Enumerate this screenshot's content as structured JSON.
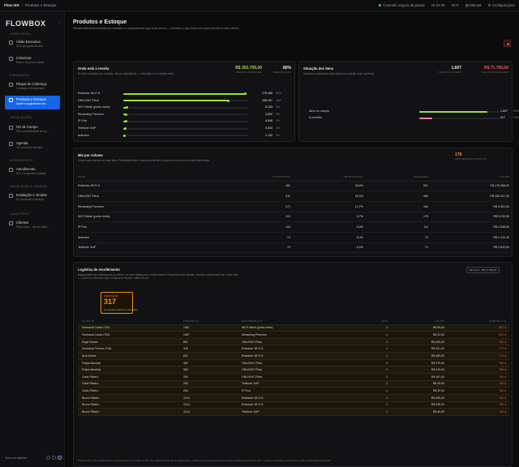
{
  "topbar": {
    "brand": "Flow ISO",
    "sep": "/",
    "crumb": "Produtos e Estoque",
    "status": "Conexão segura da pausa",
    "time": "16:24:30",
    "badge": "IS72",
    "manual": "Manual",
    "settings": "Configurações"
  },
  "sidebar": {
    "logo": "FLOWBOX",
    "caret": "⌃",
    "sections": [
      {
        "label": "VISÃO GERAL"
      },
      {
        "label": "FINANCEIRO"
      },
      {
        "label": "INSTALAÇÕES"
      },
      {
        "label": "ATENDIMENTO"
      },
      {
        "label": "INSTALAÇÃO E VENDAS"
      },
      {
        "label": "CADASTROS"
      }
    ],
    "items": [
      {
        "title": "Visão Executiva",
        "sub": "KPIs principais do mês"
      },
      {
        "title": "Cobertura",
        "sub": "Base e churn por cidade"
      },
      {
        "title": "Régua de Cobrança",
        "sub": "Cobrança e recuperação"
      },
      {
        "title": "Produtos e Estoque",
        "sub": "Upsell e equipamento em..."
      },
      {
        "title": "OS de Campo",
        "sub": "Fila e produtividade da eq..."
      },
      {
        "title": "Agenda",
        "sub": "OS com hora marcada"
      },
      {
        "title": "Atendimento",
        "sub": "SLA e carga dos analistas"
      },
      {
        "title": "Instalação e Vendas",
        "sub": "Do venda até a ativação"
      },
      {
        "title": "Clientes",
        "sub": "Ficha única – tela do client..."
      }
    ],
    "footer": "Tema do sistema"
  },
  "page": {
    "title": "Produtos e Estoque",
    "desc": "Receita adicional vendida por contrato e o equipamento que está na rua — inclusive o que ficou com quem já não é mais cliente."
  },
  "revenue": {
    "title": "Onde está a receita",
    "sub": "Do itens vendidos por contrato, não por quantidade — ordenado e é a receita sobre.",
    "kpi1_value": "R$ 352.705,00",
    "kpi1_label": "RECEITA ADICIONAL",
    "kpi2_value": "80%",
    "kpi2_label": "PENETRAÇÃO",
    "rows": [
      {
        "name": "Roteador Wi-Fi 6",
        "value": "178.458",
        "pct": "51%",
        "share": 0.51
      },
      {
        "name": "ONU/ONT Fibra",
        "value": "155.297",
        "pct": "44%",
        "share": 0.44
      },
      {
        "name": "Wi-Fi Mesh (ponto extra)",
        "value": "5.233",
        "pct": "1%",
        "share": 0.015
      },
      {
        "name": "Streaming Premium",
        "value": "4.502",
        "pct": "1%",
        "share": 0.013
      },
      {
        "name": "IP Fixo",
        "value": "4.548",
        "pct": "1%",
        "share": 0.013
      },
      {
        "name": "Telefone VoIP",
        "value": "3.543",
        "pct": "1%",
        "share": 0.01
      },
      {
        "name": "Antivírus",
        "value": "1.132",
        "pct": "0%",
        "share": 0.003
      }
    ]
  },
  "items_status": {
    "title": "Situação dos itens",
    "sub": "Cada item classificado pelo status do contrato a que pertence.",
    "kpi1_value": "1.607",
    "kpi1_label": "ITENS NO CAMPO",
    "kpi2_value": "R$ 71.760,00",
    "kpi2_label": "VALOR A RECOLHER",
    "rows": [
      {
        "name": "Ativo no campo",
        "value": "1.607",
        "pct": "84%",
        "share": 0.84,
        "color": "#9ce03a"
      },
      {
        "name": "A recolher",
        "value": "317",
        "pct": "16%",
        "share": 0.16,
        "color": "#f07ca8"
      }
    ]
  },
  "mix": {
    "title": "Mix por volume",
    "sub": "O que mais aparece na base ativa. Penetração alta e cobrindo a cliente no plano ter via de por vendido item a item.",
    "kpi_value": "178",
    "kpi_label": "SEM NENHUM PRODUTO",
    "headers": [
      "ITEM",
      "CONTRATOS",
      "PENETRAÇÃO",
      "UNIDADES",
      "VALOR"
    ],
    "rows": [
      [
        "Roteador Wi-Fi 6",
        "452",
        "36,8%",
        "521",
        "R$ 178.458,00"
      ],
      [
        "ONU/ONT Fibra",
        "311",
        "25,3%",
        "486",
        "R$ 155.297,00"
      ],
      [
        "Streaming Premium",
        "171",
        "14,7%",
        "184",
        "R$ 4.501,60"
      ],
      [
        "Wi-Fi Mesh (ponto extra)",
        "113",
        "9,7%",
        "175",
        "R$ 5.232,50"
      ],
      [
        "IP Fixo",
        "110",
        "9,5%",
        "114",
        "R$ 4.548,60"
      ],
      [
        "Antivírus",
        "74",
        "6,4%",
        "74",
        "R$ 1.132,40"
      ],
      [
        "Telefone VoIP",
        "70",
        "6,0%",
        "71",
        "R$ 3.542,60"
      ]
    ]
  },
  "logistics": {
    "title": "Logística de recolhimento",
    "sub": "Equipamento em contrato que já morreu, do mais antigo para o mais recente. Passaram perto dessas, recolher ouvido mais que o item nele — a sua é a coluna do anjo à coluna de dúvida e ativo na rua.",
    "chip": "317 itens · R$ 71.760,00",
    "callout_label": "A RECOLHER",
    "callout_value": "317",
    "callout_sub": "em contratos inativos ou cancelados",
    "headers": [
      "CLIENTE",
      "CONTRATO",
      "EQUIPAMENTO",
      "QTD",
      "VALOR",
      "PARADO HÁ"
    ],
    "rows": [
      [
        "Farmácia Costa LTDA",
        "1067",
        "Wi-Fi Mesh (ponto extra)",
        "2",
        "R$ 59,60",
        "800 d"
      ],
      [
        "Farmácia Costa LTDA",
        "1067",
        "Streaming Premium",
        "1",
        "R$ 24,90",
        "800 d"
      ],
      [
        "Hugo Nunes",
        "891",
        "ONU/ONT Fibra",
        "1",
        "R$ 455,00",
        "783 d"
      ],
      [
        "Farmácia Pereira LTDA",
        "416",
        "Roteador Wi-Fi 6",
        "1",
        "R$ 291,00",
        "772 d"
      ],
      [
        "Ana Nunes",
        "811",
        "Roteador Wi-Fi 6",
        "1",
        "R$ 489,00",
        "770 d"
      ],
      [
        "Felipe Almeida",
        "362",
        "ONU/ONT Fibra",
        "1",
        "R$ 375,00",
        "768 d"
      ],
      [
        "Felipe Almeida",
        "362",
        "ONU/ONT Fibra",
        "1",
        "R$ 319,00",
        "768 d"
      ],
      [
        "Carla Ribeiro",
        "254",
        "ONU/ONT Fibra",
        "1",
        "R$ 467,00",
        "766 d"
      ],
      [
        "Carla Ribeiro",
        "254",
        "Telefone VoIP",
        "1",
        "R$ 49,90",
        "766 d"
      ],
      [
        "Carla Ribeiro",
        "254",
        "IP Fixo",
        "1",
        "R$ 39,90",
        "766 d"
      ],
      [
        "Bruno Ribeiro",
        "1214",
        "Roteador Wi-Fi 6",
        "1",
        "R$ 495,00",
        "754 d"
      ],
      [
        "Bruno Ribeiro",
        "1214",
        "Roteador Wi-Fi 6",
        "1",
        "R$ 398,00",
        "754 d"
      ],
      [
        "Bruno Ribeiro",
        "1214",
        "Telefone VoIP",
        "1",
        "R$ 46,90",
        "754 d"
      ]
    ],
    "footnote": "\"Parado há\" conta os dias desde o cancelamento do contrato. O SIC não registra devolução de equipamento, então um item que já voltou ao estoque continua aparecendo aqui — a lista é candidata a recolhimento, não a confirmação de perda."
  }
}
